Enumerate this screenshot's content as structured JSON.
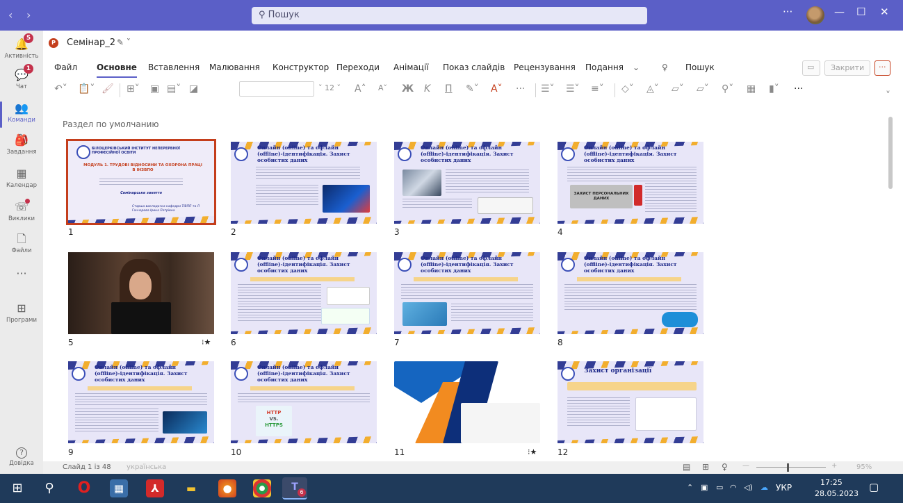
{
  "titlebar": {
    "back": "‹",
    "forward": "›",
    "search_placeholder": "Пошук",
    "more": "···",
    "minimize": "—",
    "maximize": "☐",
    "close": "✕"
  },
  "rail": [
    {
      "label": "Активність",
      "icon": "bell-icon",
      "glyph": "🔔",
      "badge": "5"
    },
    {
      "label": "Чат",
      "icon": "chat-icon",
      "glyph": "💬",
      "badge": "1"
    },
    {
      "label": "Команди",
      "icon": "teams-icon",
      "glyph": "👥",
      "active": true
    },
    {
      "label": "Завдання",
      "icon": "assignments-icon",
      "glyph": "🎒"
    },
    {
      "label": "Календар",
      "icon": "calendar-icon",
      "glyph": "▦"
    },
    {
      "label": "Виклики",
      "icon": "calls-icon",
      "glyph": "☏",
      "dot": true
    },
    {
      "label": "Файли",
      "icon": "files-icon",
      "glyph": "🗋"
    },
    {
      "label": "",
      "icon": "more-apps-icon",
      "glyph": "···"
    },
    {
      "label": "Програми",
      "icon": "apps-icon",
      "glyph": "⊞"
    },
    {
      "label": "Довідка",
      "icon": "help-icon",
      "glyph": "?"
    }
  ],
  "file": {
    "name": "Семінар_2",
    "logo": "P"
  },
  "menu": {
    "items": [
      "Файл",
      "Основне",
      "Вставлення",
      "Малювання",
      "Конструктор",
      "Переходи",
      "Анімації",
      "Показ слайдів",
      "Рецензування",
      "Подання"
    ],
    "active": "Основне",
    "search_label": "Пошук",
    "close_label": "Закрити",
    "more": "···"
  },
  "ribbon": {
    "font_size": "12"
  },
  "section_label": "Раздел по умолчанию",
  "slides": [
    {
      "num": "1",
      "title": "МОДУЛЬ 1. ТРУДОВІ ВІДНОСИНИ ТА ОХОРОНА ПРАЦІ В ІНЗВПО",
      "org": "БІЛОЦЕРКІВСЬКИЙ ІНСТИТУТ НЕПЕРЕРВНОЇ ПРОФЕСІЙНОЇ ОСВІТИ",
      "sub": "Семінарське заняття",
      "author": "Старша викладачка кафедри ТІВПП та Л Гончарова Ірина Петрівна",
      "icon": ""
    },
    {
      "num": "2",
      "title": "Онлайн (online) та офлайн (offline)-ідентифікація. Захист особистих даних",
      "icon": ""
    },
    {
      "num": "3",
      "title": "Онлайн (online) та офлайн (offline)-ідентифікація. Захист особистих даних",
      "icon": ""
    },
    {
      "num": "4",
      "title": "Онлайн (online) та офлайн (offline)-ідентифікація. Захист особистих даних",
      "icon": ""
    },
    {
      "num": "5",
      "title": "",
      "icon": "⁝★"
    },
    {
      "num": "6",
      "title": "Онлайн (online) та офлайн (offline)-ідентифікація. Захист особистих даних",
      "icon": ""
    },
    {
      "num": "7",
      "title": "Онлайн (online) та офлайн (offline)-ідентифікація. Захист особистих даних",
      "icon": ""
    },
    {
      "num": "8",
      "title": "Онлайн (online) та офлайн (offline)-ідентифікація. Захист особистих даних",
      "icon": ""
    },
    {
      "num": "9",
      "title": "Онлайн (online) та офлайн (offline)-ідентифікація. Захист особистих даних",
      "icon": ""
    },
    {
      "num": "10",
      "title": "Онлайн (online) та офлайн (offline)-ідентифікація. Захист особистих даних",
      "icon": ""
    },
    {
      "num": "11",
      "title": "",
      "icon": "⁝★"
    },
    {
      "num": "12",
      "title": "Захист організації",
      "icon": ""
    }
  ],
  "slide_misc": {
    "http": "HTTP",
    "vs": "VS.",
    "https": "HTTPS",
    "protect": "ЗАХИСТ ПЕРСОНАЛЬНИХ ДАНИХ"
  },
  "status": {
    "slide_info": "Слайд 1 із 48",
    "language": "українська",
    "zoom": "95%"
  },
  "taskbar": {
    "lang": "УКР",
    "time": "17:25",
    "date": "28.05.2023",
    "teams_badge": "6"
  }
}
